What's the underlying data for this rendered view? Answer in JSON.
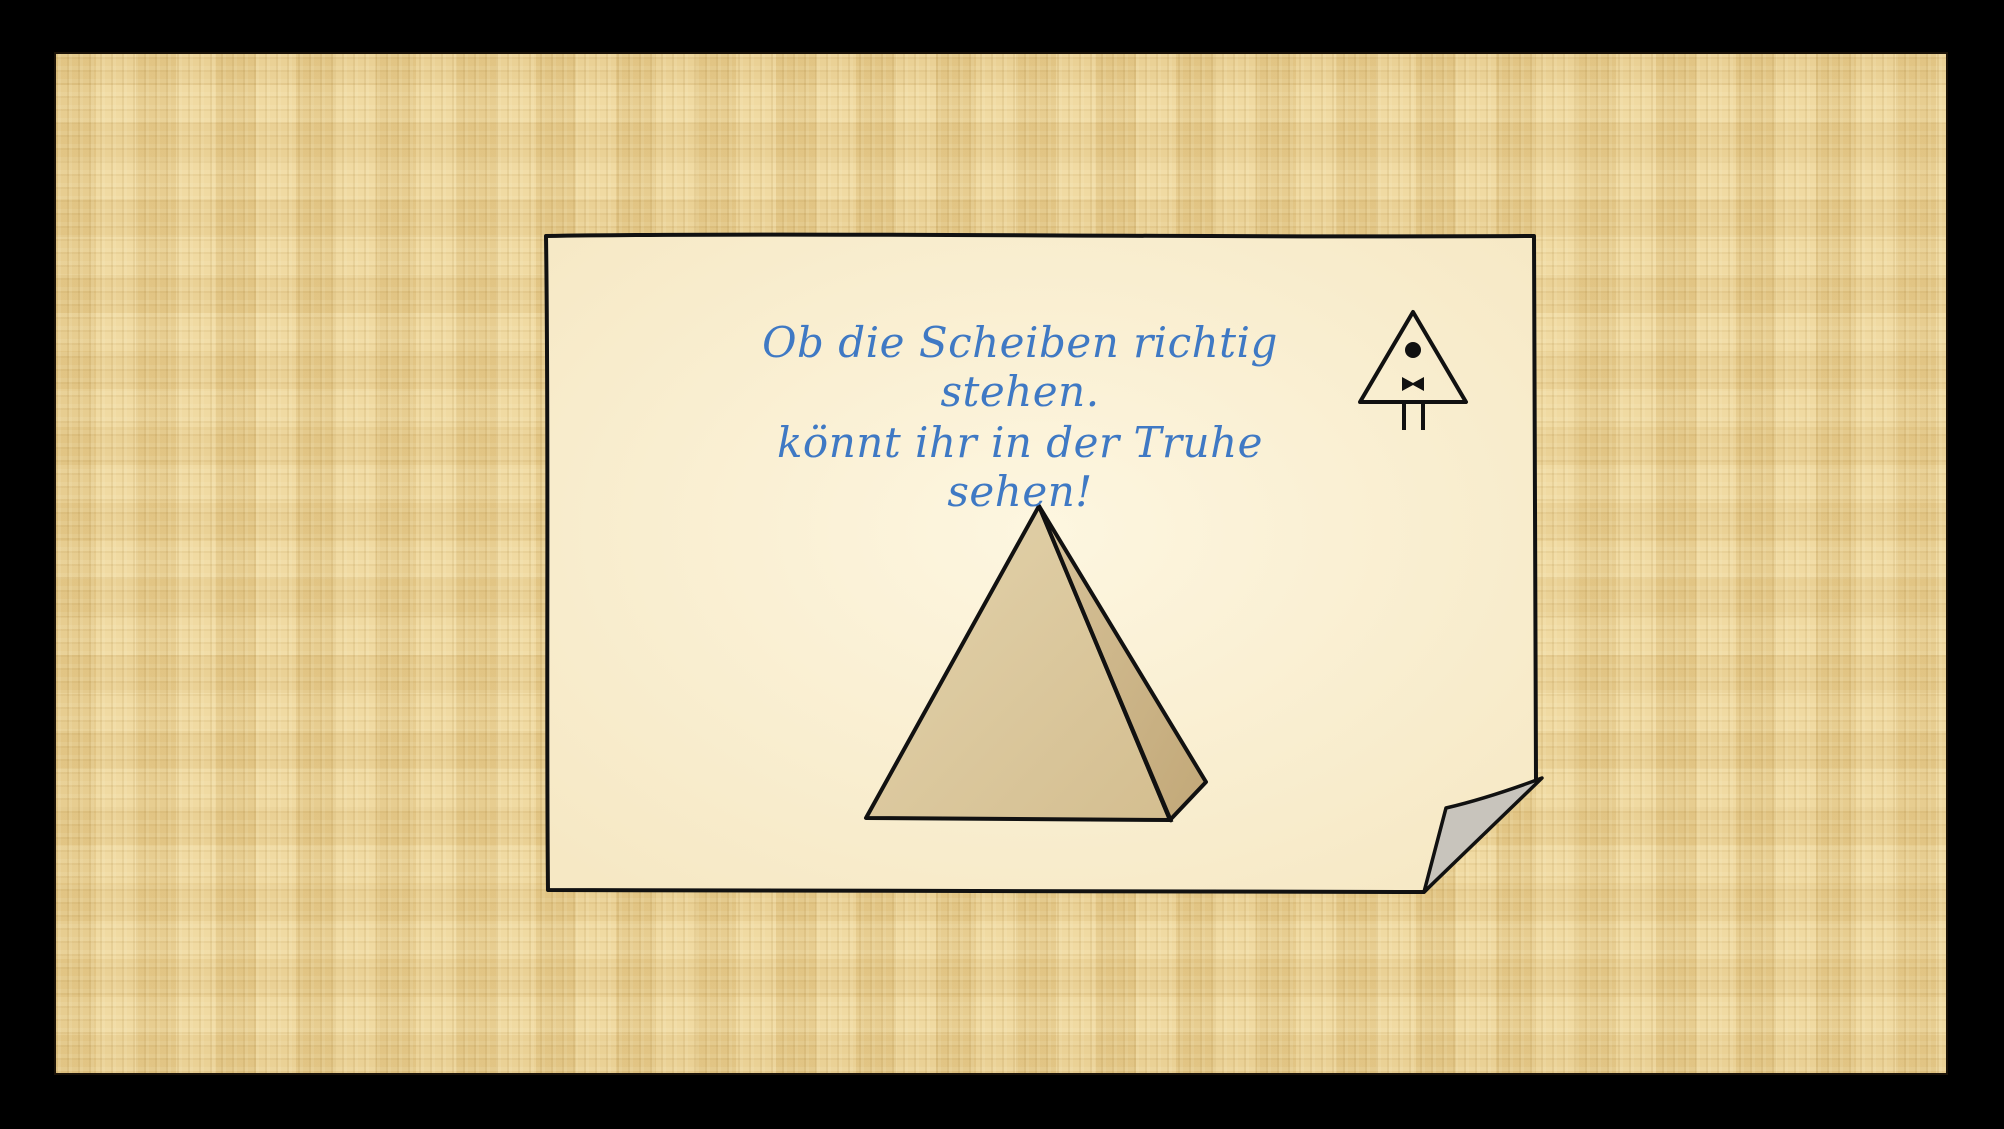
{
  "riddle": {
    "line1": "Ob die Scheiben richtig stehen.",
    "line2": "könnt ihr in der Truhe sehen!"
  },
  "icons": {
    "signature": "triangle-eye-with-bowtie-icon",
    "artifact": "pyramid-icon",
    "corner": "page-curl-icon"
  },
  "colors": {
    "frame": "#000000",
    "papyrus": "#ecd49a",
    "note_paper": "#fbf0d4",
    "riddle_text": "#3f79c4",
    "pyramid_face": "#d9c49a",
    "pyramid_side": "#c9b48a",
    "page_curl": "#c8c4bc"
  }
}
